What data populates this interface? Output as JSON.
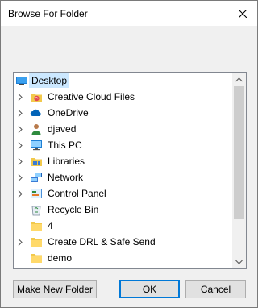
{
  "window": {
    "title": "Browse For Folder"
  },
  "tree": {
    "items": [
      {
        "label": "Desktop",
        "icon": "desktop-icon",
        "expandable": false,
        "selected": true,
        "root": true
      },
      {
        "label": "Creative Cloud Files",
        "icon": "creative-cloud-folder-icon",
        "expandable": true
      },
      {
        "label": "OneDrive",
        "icon": "onedrive-cloud-icon",
        "expandable": true
      },
      {
        "label": "djaved",
        "icon": "user-folder-icon",
        "expandable": true
      },
      {
        "label": "This PC",
        "icon": "computer-icon",
        "expandable": true
      },
      {
        "label": "Libraries",
        "icon": "libraries-icon",
        "expandable": true
      },
      {
        "label": "Network",
        "icon": "network-icon",
        "expandable": true
      },
      {
        "label": "Control Panel",
        "icon": "control-panel-icon",
        "expandable": true
      },
      {
        "label": "Recycle Bin",
        "icon": "recycle-bin-icon",
        "expandable": false
      },
      {
        "label": "4",
        "icon": "folder-icon",
        "expandable": false
      },
      {
        "label": "Create DRL & Safe Send",
        "icon": "folder-icon",
        "expandable": true
      },
      {
        "label": "demo",
        "icon": "folder-icon",
        "expandable": false
      }
    ]
  },
  "buttons": {
    "new_folder": "Make New Folder",
    "ok": "OK",
    "cancel": "Cancel"
  },
  "colors": {
    "selection": "#cce8ff",
    "folder": "#f2c94c",
    "default_button_border": "#0078d7"
  }
}
